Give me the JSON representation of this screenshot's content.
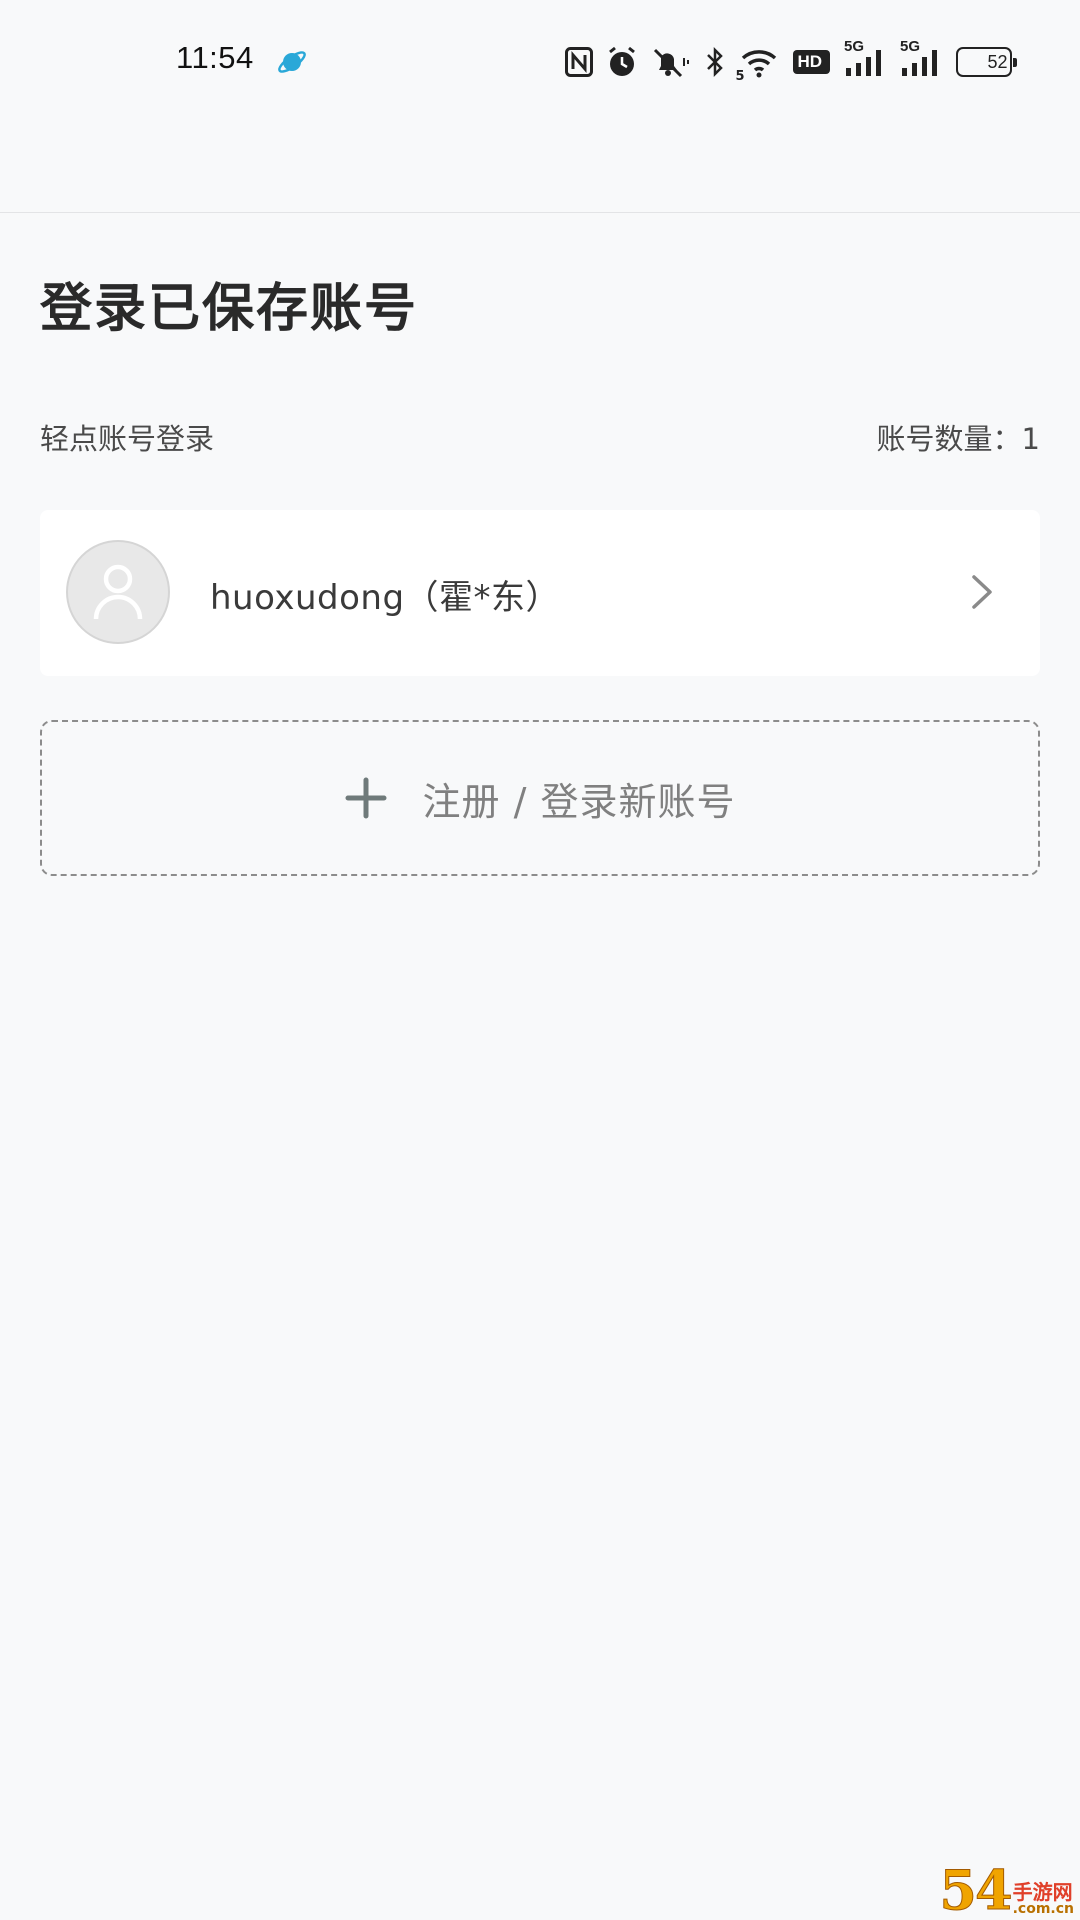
{
  "status_bar": {
    "time": "11:54",
    "icons": [
      "planet-icon",
      "nfc-icon",
      "alarm-icon",
      "mute-icon",
      "bluetooth-icon",
      "wifi-icon",
      "hd-icon",
      "signal-5g-icon",
      "signal-5g-icon-2",
      "battery-icon"
    ],
    "hd_label": "HD",
    "net_label_1": "5G",
    "net_label_2": "5G",
    "wifi_label": "5",
    "battery_level": "52"
  },
  "page": {
    "title": "登录已保存账号",
    "hint_left": "轻点账号登录",
    "count_label": "账号数量：1"
  },
  "accounts": [
    {
      "name": "huoxudong（霍*东）",
      "avatar": "user-avatar-icon"
    }
  ],
  "add_account": {
    "label": "注册 / 登录新账号",
    "icon": "plus-icon"
  },
  "watermark": {
    "big": "54",
    "cn": "手游网",
    "com": ".com.cn"
  },
  "colors": {
    "background": "#f8f9fa",
    "card": "#ffffff",
    "accent_planet": "#2aa8d8",
    "dashed_border": "#8c8c8c"
  }
}
